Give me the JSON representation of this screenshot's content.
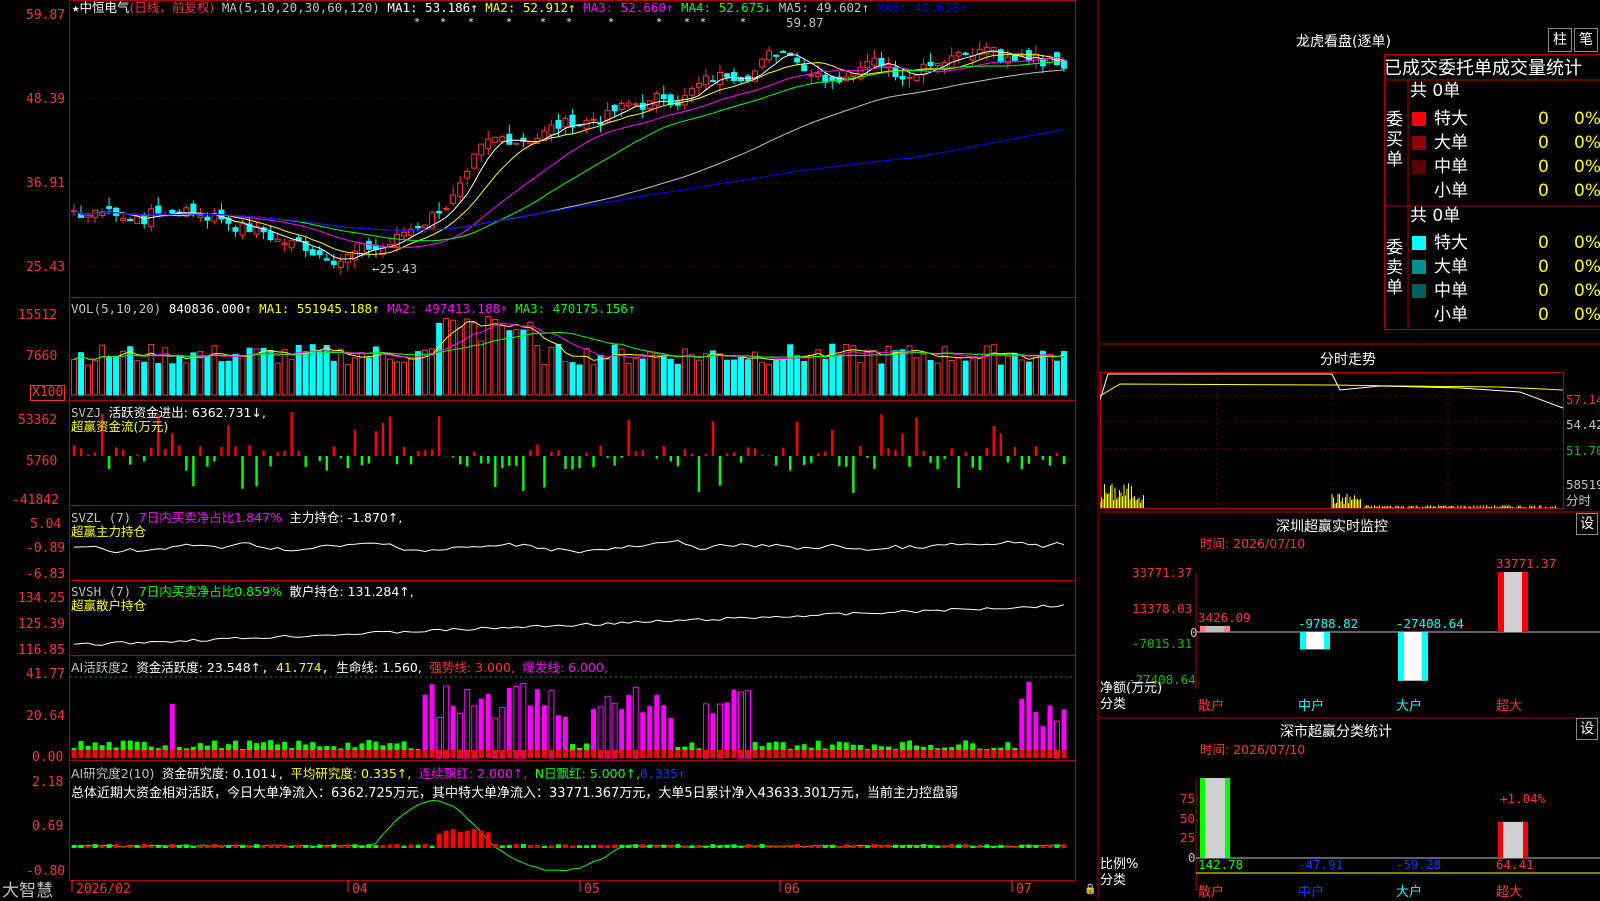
{
  "stock": {
    "star": "★",
    "name": "中恒电气",
    "mode": "(日线，前复权)",
    "ma_title": "MA(5,10,20,30,60,120)",
    "ma1": "MA1: 53.186↑",
    "ma2": "MA2: 52.912↑",
    "ma3": "MA3: 52.660↑",
    "ma4": "MA4: 52.675↓",
    "ma5": "MA5: 49.602↑",
    "ma6": "MA6: 40.638↑",
    "high_label": "59.87",
    "low_label": "←25.43"
  },
  "price_axis": [
    "59.87",
    "48.39",
    "36.91",
    "25.43"
  ],
  "vol": {
    "title": "VOL(5,10,20)",
    "value": "840836.000↑",
    "ma1": "MA1: 551945.188↑",
    "ma2": "MA2: 497413.188↑",
    "ma3": "MA3: 470175.156↑",
    "axis": [
      "15512",
      "7660",
      "X100"
    ]
  },
  "svzj": {
    "title": "SVZJ",
    "label": "活跃资金进出: 6362.731↓,",
    "sub": "超赢资金流(万元)",
    "axis": [
      "53362",
      "5760",
      "-41842"
    ]
  },
  "svzl": {
    "title": "SVZL (7)",
    "ratio": "7日内买卖净占比1.847%",
    "hold": "主力持仓: -1.870↑,",
    "sub": "超赢主力持仓",
    "axis": [
      "5.04",
      "-0.89",
      "-6.83"
    ]
  },
  "svsh": {
    "title": "SVSH (7)",
    "ratio": "7日内买卖净占比0.859%",
    "hold": "散户持仓: 131.284↑,",
    "sub": "超赢散户持仓",
    "axis": [
      "134.25",
      "125.39",
      "116.85"
    ]
  },
  "ai1": {
    "title": "AI活跃度2",
    "a": "资金活跃度: 23.548↑",
    "b": ", 41.774,",
    "c": "生命线: 1.560,",
    "d": "强势线: 3.000,",
    "e": "爆发线: 6.000,",
    "axis": [
      "41.77",
      "20.64",
      "0.00"
    ]
  },
  "ai2": {
    "title": "AI研究度2(10)",
    "a": "资金研究度: 0.101↓,",
    "b": "平均研究度: 0.335↑,",
    "c": "连续飘红: 2.000↑,",
    "d": "N日飘红: 5.000↑,",
    "e": "0.335↑",
    "summary": "总体近期大资金相对活跃，今日大单净流入：6362.725万元，其中特大单净流入：33771.367万元，大单5日累计净入43633.301万元，当前主力控盘弱",
    "axis": [
      "2.18",
      "0.69",
      "-0.80"
    ]
  },
  "date_axis": {
    "brand": "大智慧",
    "labels": [
      "2026/02",
      "04",
      "05",
      "06",
      "07"
    ]
  },
  "side": {
    "top_title": "龙虎看盘(逐单)",
    "btn_zhu": "柱",
    "btn_bi": "笔",
    "table_title": "已成交委托单成交量统计",
    "buy_label": "委买单",
    "sell_label": "委卖单",
    "buy_total": "共 0单",
    "sell_total": "共 0单",
    "buy_rows": [
      {
        "name": "特大",
        "count": "0",
        "pct": "0%",
        "color": "#ff0000"
      },
      {
        "name": "大单",
        "count": "0",
        "pct": "0%",
        "color": "#8b0000"
      },
      {
        "name": "中单",
        "count": "0",
        "pct": "0%",
        "color": "#5a0000"
      },
      {
        "name": "小单",
        "count": "0",
        "pct": "0%",
        "color": ""
      }
    ],
    "sell_rows": [
      {
        "name": "特大",
        "count": "0",
        "pct": "0%",
        "color": "#00ffff"
      },
      {
        "name": "大单",
        "count": "0",
        "pct": "0%",
        "color": "#009090"
      },
      {
        "name": "中单",
        "count": "0",
        "pct": "0%",
        "color": "#006060"
      },
      {
        "name": "小单",
        "count": "0",
        "pct": "0%",
        "color": ""
      }
    ],
    "intraday_title": "分时走势",
    "intraday_axis": [
      "57.14",
      "54.42",
      "51.70",
      "58519",
      "分时"
    ],
    "monitor_title": "深圳超赢实时监控",
    "monitor_btn": "设",
    "monitor_time": "时间: 2026/07/10",
    "monitor_axis": [
      "33771.37",
      "13378.03",
      "0",
      "-7015.31",
      "-27408.64"
    ],
    "monitor_values": [
      {
        "name": "散户",
        "value": 3426.09,
        "label": "3426.09"
      },
      {
        "name": "中户",
        "value": -9788.82,
        "label": "-9788.82"
      },
      {
        "name": "大户",
        "value": -27408.64,
        "label": "-27408.64"
      },
      {
        "name": "超大",
        "value": 33771.37,
        "label": "33771.37"
      }
    ],
    "monitor_ylabel": "净额(万元)",
    "monitor_xlabel": "分类",
    "stats_title": "深市超赢分类统计",
    "stats_btn": "设",
    "stats_time": "时间: 2026/07/10",
    "stats_axis": [
      "75",
      "50",
      "25",
      "0"
    ],
    "stats_values": [
      {
        "name": "散户",
        "value": 142.78,
        "label": "142.78"
      },
      {
        "name": "中户",
        "value": -47.91,
        "label": "-47.91"
      },
      {
        "name": "大户",
        "value": -59.28,
        "label": "-59.28"
      },
      {
        "name": "超大",
        "value": 64.41,
        "label": "64.41"
      }
    ],
    "stats_extra": "+1.04%",
    "stats_ylabel": "比例%",
    "stats_xlabel": "分类"
  }
}
